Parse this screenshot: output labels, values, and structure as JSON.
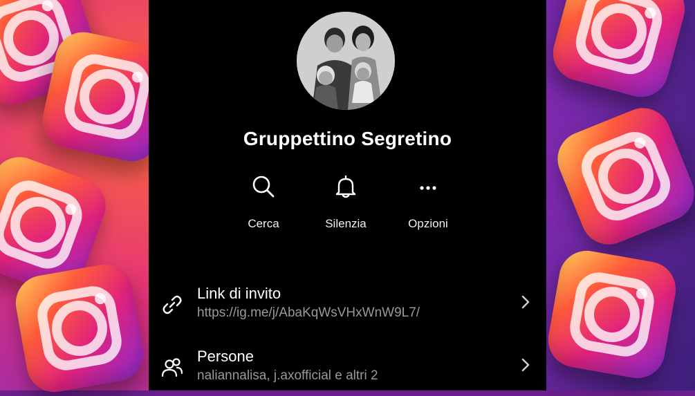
{
  "group": {
    "name": "Gruppettino Segretino",
    "avatar_icon": "group-photo"
  },
  "actions": [
    {
      "label": "Cerca",
      "icon": "search-icon"
    },
    {
      "label": "Silenzia",
      "icon": "bell-icon"
    },
    {
      "label": "Opzioni",
      "icon": "more-icon"
    }
  ],
  "rows": {
    "invite": {
      "title": "Link di invito",
      "subtitle": "https://ig.me/j/AbaKqWsVHxWnW9L7/",
      "icon": "link-icon"
    },
    "people": {
      "title": "Persone",
      "subtitle": "naliannalisa, j.axofficial e altri 2",
      "icon": "people-icon"
    }
  },
  "colors": {
    "panel": "#000000",
    "text": "#ffffff",
    "secondary_text": "#9a9a9a"
  }
}
